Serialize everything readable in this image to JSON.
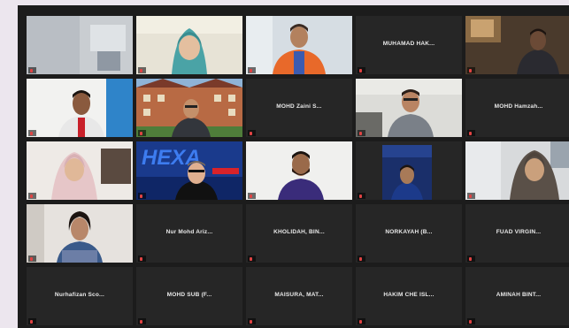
{
  "meeting": {
    "tiles": [
      {
        "type": "video",
        "scene": "room-gray",
        "label": ""
      },
      {
        "type": "video",
        "scene": "hijab-teal",
        "label": "",
        "speaking": true
      },
      {
        "type": "video",
        "scene": "orange-shirt",
        "label": ""
      },
      {
        "type": "name",
        "name": "MUHAMAD HAK...",
        "label": ""
      },
      {
        "type": "video",
        "scene": "man-dark-room",
        "label": ""
      },
      {
        "type": "video",
        "scene": "man-white-wall",
        "label": ""
      },
      {
        "type": "video",
        "scene": "building-bg",
        "label": ""
      },
      {
        "type": "name",
        "name": "MOHD Zaini S...",
        "label": ""
      },
      {
        "type": "video",
        "scene": "man-glasses-office",
        "label": ""
      },
      {
        "type": "name",
        "name": "MOHD Hamzah...",
        "label": ""
      },
      {
        "type": "video",
        "scene": "hijab-pink",
        "label": ""
      },
      {
        "type": "video",
        "scene": "hexa-bg",
        "label": "",
        "text": "HEXA"
      },
      {
        "type": "video",
        "scene": "man-beard-white",
        "label": ""
      },
      {
        "type": "video",
        "scene": "man-blue-bg",
        "label": ""
      },
      {
        "type": "video",
        "scene": "hijab-dark",
        "label": ""
      },
      {
        "type": "video",
        "scene": "woman-hair",
        "label": ""
      },
      {
        "type": "name",
        "name": "Nur Mohd Ariz...",
        "label": ""
      },
      {
        "type": "name",
        "name": "KHOLIDAH, BIN...",
        "label": ""
      },
      {
        "type": "name",
        "name": "NORKAYAH (B...",
        "label": ""
      },
      {
        "type": "name",
        "name": "FUAD VIRGIN...",
        "label": ""
      },
      {
        "type": "name",
        "name": "Nurhafizan Sco...",
        "label": ""
      },
      {
        "type": "name",
        "name": "MOHD SUB (F...",
        "label": ""
      },
      {
        "type": "name",
        "name": "MAISURA, MAT...",
        "label": ""
      },
      {
        "type": "name",
        "name": "HAKIM CHE ISL...",
        "label": ""
      },
      {
        "type": "name",
        "name": "AMINAH BINT...",
        "label": ""
      }
    ]
  },
  "colors": {
    "window_bg": "#1c1c1c",
    "tile_bg": "#262626",
    "speaker_outline": "#8fd13a",
    "page_bg": "#ece6ee"
  }
}
